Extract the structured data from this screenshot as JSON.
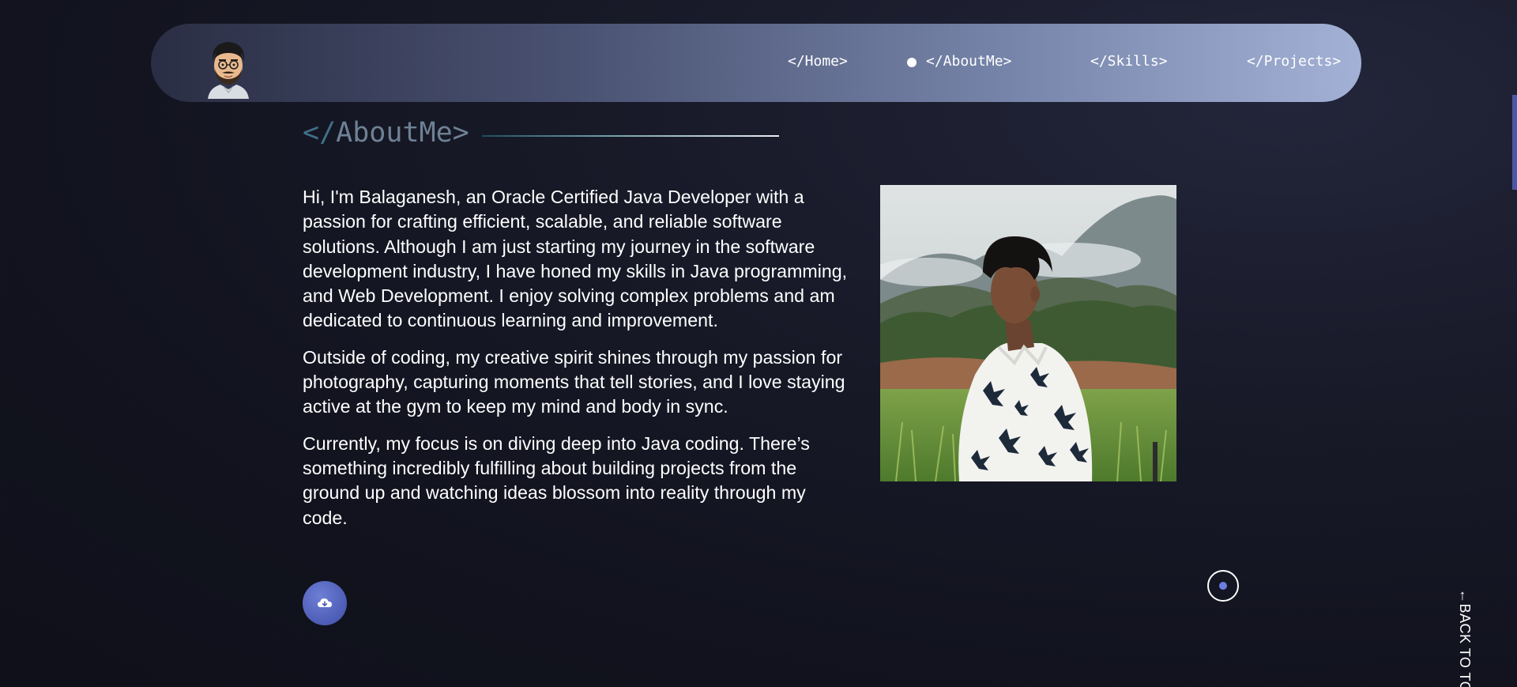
{
  "nav": {
    "links": [
      {
        "label": "</Home>"
      },
      {
        "label": "</AboutMe>"
      },
      {
        "label": "</Skills>"
      },
      {
        "label": "</Projects>"
      }
    ]
  },
  "about": {
    "heading_slash": "</",
    "heading_text": "AboutMe>",
    "paragraphs": [
      "Hi, I'm Balaganesh, an Oracle Certified Java Developer with a passion for crafting efficient, scalable, and reliable software solutions. Although I am just starting my journey in the software development industry, I have honed my skills in Java programming, and Web Development. I enjoy solving complex problems and am dedicated to continuous learning and improvement.",
      "Outside of coding, my creative spirit shines through my passion for photography, capturing moments that tell stories, and I love staying active at the gym to keep my mind and body in sync.",
      "Currently, my focus is on diving deep into Java coding. There’s something incredibly fulfilling about building projects from the ground up and watching ideas blossom into reality through my code."
    ]
  },
  "back_to_top": "←BACK TO TOP",
  "icons": {
    "download": "cloud-download-icon",
    "avatar": "avatar-emoji",
    "photo": "profile-photo"
  },
  "colors": {
    "background": "#11121d",
    "accent": "#4d5cb5",
    "heading": "#6e8195",
    "heading_slash": "#3f6f86",
    "cursor_dot": "#6c7fe0"
  }
}
